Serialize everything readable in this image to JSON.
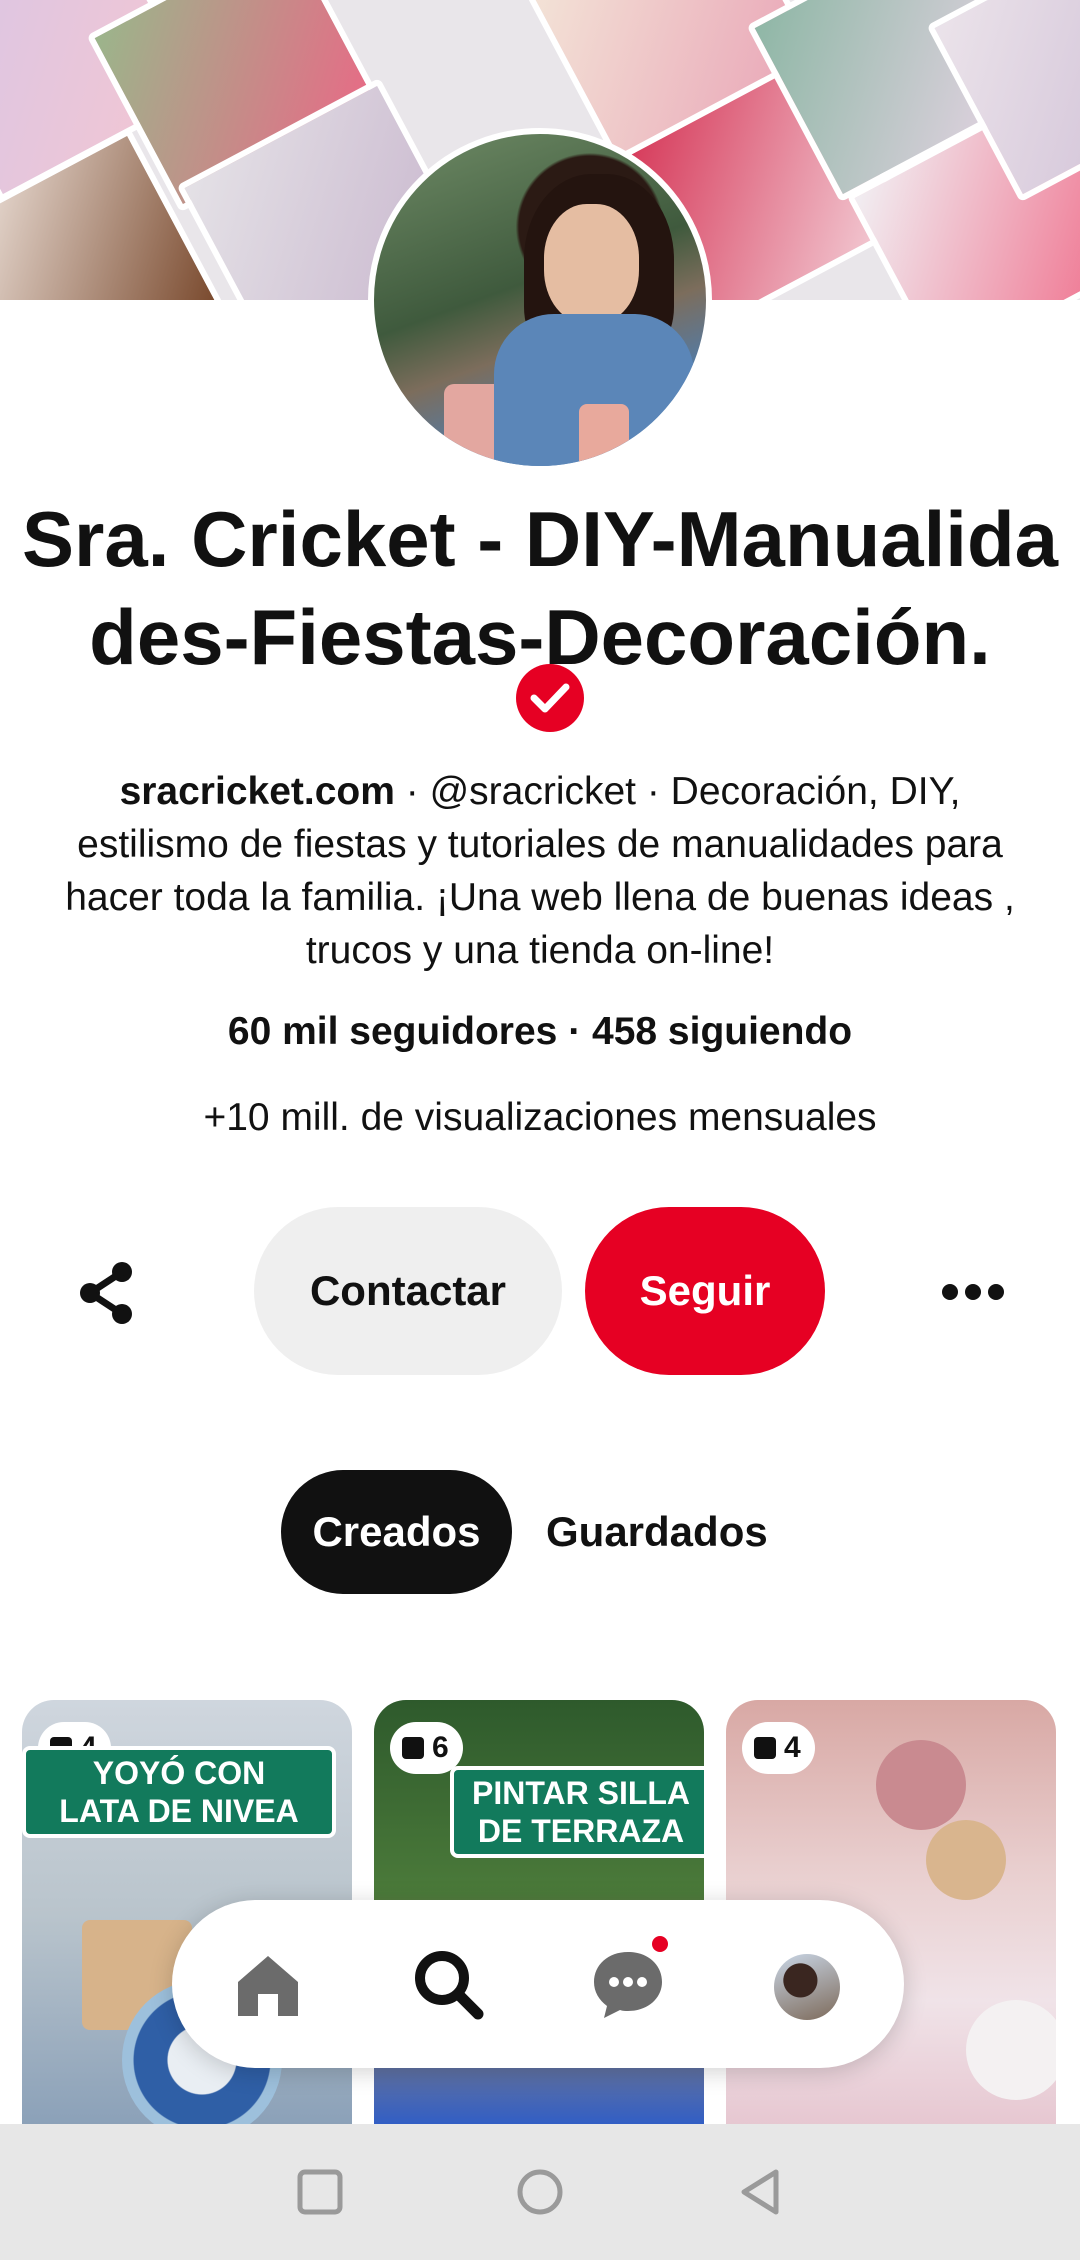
{
  "profile": {
    "name": "Sra. Cricket - DIY-Manualidades-Fiestas-Decoración.",
    "website": "sracricket.com",
    "bio_rest": " · @sracricket · Decoración, DIY, estilismo de fiestas y tutoriales de manualidades para hacer toda la familia. ¡Una web llena de buenas ideas , trucos y una tienda on-line!",
    "stats": "60 mil seguidores · 458 siguiendo",
    "views": "+10 mill. de visualizaciones mensuales",
    "verified_color": "#e60023"
  },
  "actions": {
    "contact_label": "Contactar",
    "follow_label": "Seguir"
  },
  "tabs": {
    "created": "Creados",
    "saved": "Guardados"
  },
  "pins": [
    {
      "count": "4",
      "text_line1": "YOYÓ CON",
      "text_line2": "LATA DE NIVEA"
    },
    {
      "count": "6",
      "text_line1": "PINTAR SILLA",
      "text_line2": "DE TERRAZA"
    },
    {
      "count": "4"
    }
  ],
  "nav": {
    "items": [
      "home-icon",
      "search-icon",
      "messages-icon",
      "profile-avatar"
    ],
    "notification_color": "#e60023"
  },
  "system_nav": [
    "recent-apps-icon",
    "home-circle-icon",
    "back-icon"
  ]
}
